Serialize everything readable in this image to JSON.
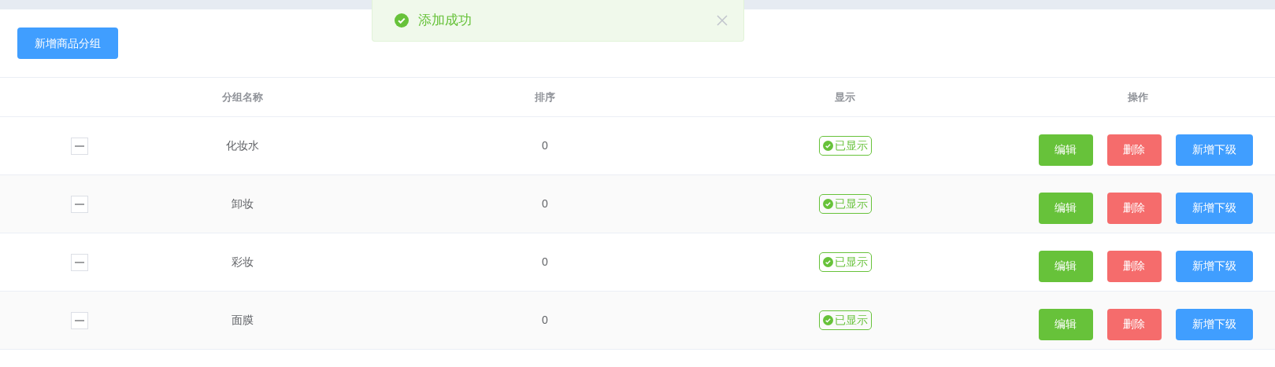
{
  "toast": {
    "kind": "success",
    "message": "添加成功"
  },
  "add_button": "新增商品分组",
  "table": {
    "columns": [
      "分组名称",
      "排序",
      "显示",
      "操作"
    ],
    "rows": [
      {
        "expanded": true,
        "name": "化妆水",
        "sort": "0",
        "display": {
          "on": true,
          "label": "已显示"
        },
        "actions": [
          {
            "kind": "edit",
            "label": "编辑"
          },
          {
            "kind": "delete",
            "label": "删除"
          },
          {
            "kind": "add",
            "label": "新增下级"
          }
        ]
      },
      {
        "expanded": true,
        "name": "卸妆",
        "sort": "0",
        "display": {
          "on": true,
          "label": "已显示"
        },
        "actions": [
          {
            "kind": "edit",
            "label": "编辑"
          },
          {
            "kind": "delete",
            "label": "删除"
          },
          {
            "kind": "add",
            "label": "新增下级"
          }
        ]
      },
      {
        "expanded": true,
        "name": "彩妆",
        "sort": "0",
        "display": {
          "on": true,
          "label": "已显示"
        },
        "actions": [
          {
            "kind": "edit",
            "label": "编辑"
          },
          {
            "kind": "delete",
            "label": "删除"
          },
          {
            "kind": "add",
            "label": "新增下级"
          }
        ]
      },
      {
        "expanded": true,
        "name": "面膜",
        "sort": "0",
        "display": {
          "on": true,
          "label": "已显示"
        },
        "actions": [
          {
            "kind": "edit",
            "label": "编辑"
          },
          {
            "kind": "delete",
            "label": "删除"
          },
          {
            "kind": "add",
            "label": "新增下级"
          }
        ]
      }
    ]
  }
}
